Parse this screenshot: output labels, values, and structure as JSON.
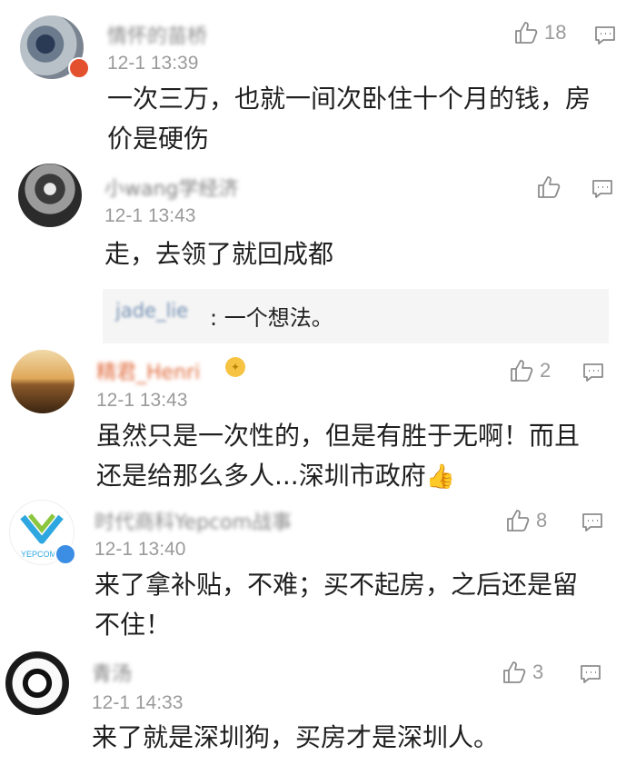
{
  "comments": [
    {
      "username": "情怀的苗桥",
      "time": "12-1 13:39",
      "text_lines": [
        "一次三万，也就一间次卧住十个月的钱，房",
        "价是硬伤"
      ],
      "likes": "18"
    },
    {
      "username": "小wang学经济",
      "time": "12-1 13:43",
      "text_lines": [
        "走，去领了就回成都"
      ],
      "likes": "",
      "reply": {
        "user": "jade_lie",
        "text": "一个想法。"
      }
    },
    {
      "username": "精君_Henri",
      "time": "12-1 13:43",
      "text_lines": [
        "虽然只是一次性的，但是有胜于无啊！而且",
        "还是给那么多人...深圳市政府"
      ],
      "likes": "2"
    },
    {
      "username": "时代商科Yepcom战事",
      "time": "12-1 13:40",
      "text_lines": [
        "来了拿补贴，不难；买不起房，之后还是留",
        "不住！"
      ],
      "likes": "8"
    },
    {
      "username": "青汤",
      "time": "12-1 14:33",
      "text_lines": [
        "来了就是深圳狗，买房才是深圳人。"
      ],
      "likes": "3"
    }
  ],
  "icons": {
    "like": "thumbs-up-outline-icon",
    "reply": "comment-bubble-icon",
    "emoji": "thumbs-up-emoji"
  },
  "colors": {
    "time": "#9a9a9a",
    "reply_bg": "#f5f5f5",
    "reply_user": "#7590b3",
    "username_1": "#8a8a8a",
    "username_3": "#e06a3b"
  }
}
